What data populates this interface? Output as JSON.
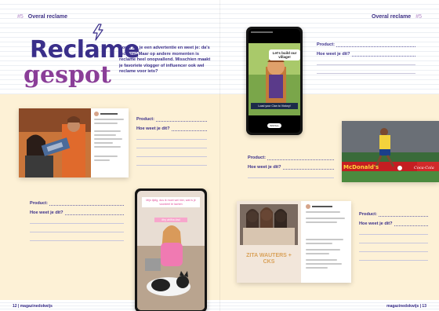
{
  "header": {
    "left_section": "#5",
    "left_title": "Overal reclame",
    "right_title": "Overal reclame",
    "right_section": "#5"
  },
  "title": {
    "line1": "Reclame",
    "line2": "gespot"
  },
  "intro": "Soms zie je een advertentie en weet je: da's reclame! Maar op andere momenten is reclame heel onopvallend. Misschien maakt je favoriete vlogger of influencer ook wel reclame voor iets?",
  "worksheet": {
    "product_label": "Product:",
    "question_label": "Hoe weet je dit?"
  },
  "ads": {
    "game_top": "Let's build our village!",
    "game_bottom": "Load your Clan to Victory!",
    "game_button": "INSTALL",
    "football_board": "McDonald's",
    "football_board2": "Coca-Cola",
    "story_caption": "Mijn tijdig, dus ik moet wel hier, wat is je voordeel te lachen",
    "story_tag": "#hy ahliha #ad",
    "book_text": "ZITA WAUTERS + CKS"
  },
  "footer": {
    "left": "12 | magazinedokwijs",
    "right": "magazinedokwijs | 13"
  },
  "colors": {
    "navy": "#3a2f8a",
    "purple": "#8a3e98",
    "cream": "#fdf1d6"
  }
}
